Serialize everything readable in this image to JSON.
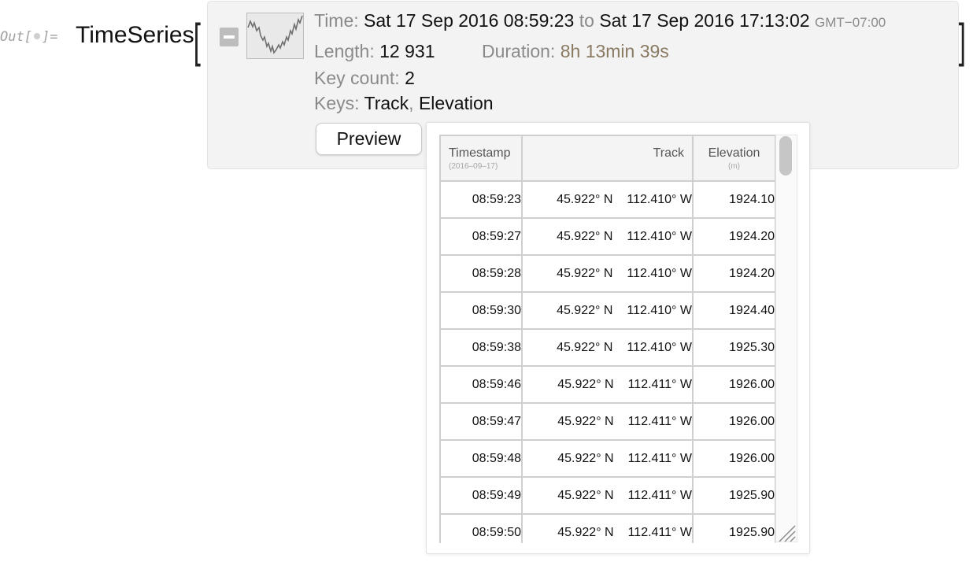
{
  "cell": {
    "out_prefix": "Out[",
    "out_suffix": "]=",
    "head": "TimeSeries",
    "open_bracket": "[",
    "close_bracket": "]"
  },
  "summary": {
    "time_label": "Time:",
    "time_start": "Sat 17 Sep 2016 08:59:23",
    "to_word": "to",
    "time_end": "Sat 17 Sep 2016 17:13:02",
    "timezone": "GMT−07:00",
    "length_label": "Length:",
    "length_value": "12 931",
    "duration_label": "Duration:",
    "duration_value": "8h 13min 39s",
    "keycount_label": "Key count:",
    "keycount_value": "2",
    "keys_label": "Keys:",
    "key_1": "Track",
    "key_sep": ",",
    "key_2": "Elevation",
    "preview_button": "Preview"
  },
  "table": {
    "headers": {
      "timestamp": "Timestamp",
      "timestamp_sub": "(2016–09–17)",
      "track": "Track",
      "elevation": "Elevation",
      "elevation_sub": "(m)"
    },
    "rows": [
      {
        "time": "08:59:23",
        "lat": "45.922° N",
        "lon": "112.410° W",
        "elev": "1924.10"
      },
      {
        "time": "08:59:27",
        "lat": "45.922° N",
        "lon": "112.410° W",
        "elev": "1924.20"
      },
      {
        "time": "08:59:28",
        "lat": "45.922° N",
        "lon": "112.410° W",
        "elev": "1924.20"
      },
      {
        "time": "08:59:30",
        "lat": "45.922° N",
        "lon": "112.410° W",
        "elev": "1924.40"
      },
      {
        "time": "08:59:38",
        "lat": "45.922° N",
        "lon": "112.410° W",
        "elev": "1925.30"
      },
      {
        "time": "08:59:46",
        "lat": "45.922° N",
        "lon": "112.411° W",
        "elev": "1926.00"
      },
      {
        "time": "08:59:47",
        "lat": "45.922° N",
        "lon": "112.411° W",
        "elev": "1926.00"
      },
      {
        "time": "08:59:48",
        "lat": "45.922° N",
        "lon": "112.411° W",
        "elev": "1926.00"
      },
      {
        "time": "08:59:49",
        "lat": "45.922° N",
        "lon": "112.411° W",
        "elev": "1925.90"
      },
      {
        "time": "08:59:50",
        "lat": "45.922° N",
        "lon": "112.411° W",
        "elev": "1925.90"
      }
    ]
  },
  "icons": {
    "collapse": "minus-box-icon",
    "thumbnail": "sparkline-thumbnail",
    "resize": "resize-grip-icon"
  },
  "colors": {
    "label_gray": "#8a8a8a",
    "duration_brown": "#8a7a62",
    "panel_bg": "#f3f3f3"
  }
}
